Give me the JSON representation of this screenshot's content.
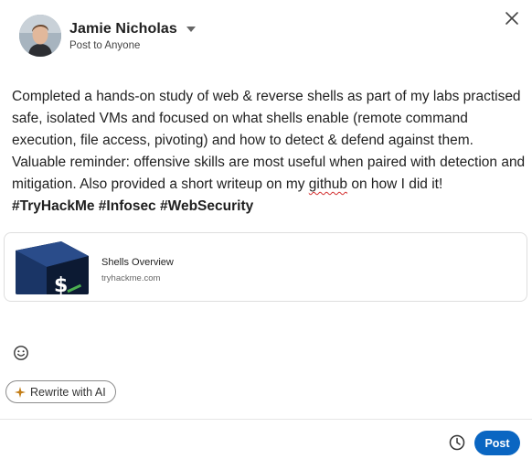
{
  "author": {
    "name": "Jamie Nicholas",
    "visibility": "Post to Anyone"
  },
  "post": {
    "text_before_spell": "Completed a hands-on study of web & reverse shells as part of my labs practised safe, isolated VMs and focused on what shells enable (remote command execution, file access, pivoting) and how to detect & defend against them. Valuable reminder: offensive skills are most useful when paired with detection and mitigation. Also provided a short writeup on my ",
    "spell_word": "github",
    "text_after_spell": " on how I did it! ",
    "hashtags": [
      "#TryHackMe",
      "#Infosec",
      "#WebSecurity"
    ]
  },
  "link_card": {
    "title": "Shells Overview",
    "domain": "tryhackme.com"
  },
  "actions": {
    "rewrite_label": "Rewrite with AI",
    "post_label": "Post"
  },
  "icons": {
    "close": "close-icon",
    "dropdown": "caret-down-icon",
    "emoji": "emoji-icon",
    "sparkle": "sparkle-icon",
    "schedule": "clock-icon"
  },
  "colors": {
    "accent": "#0a66c2",
    "sparkle": "#c37d16",
    "thumb_dark": "#0f1f3a",
    "thumb_mid": "#2a4c8a",
    "thumb_accent": "#4caf50"
  }
}
